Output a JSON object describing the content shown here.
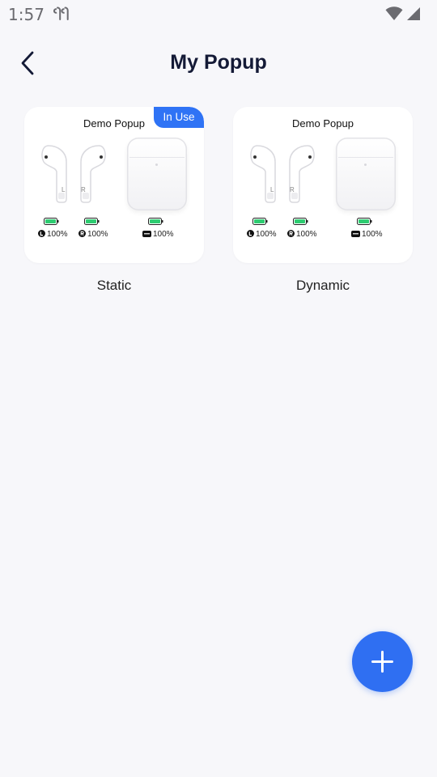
{
  "status_bar": {
    "time": "1:57"
  },
  "header": {
    "title": "My Popup"
  },
  "popups": [
    {
      "card_title": "Demo Popup",
      "badge": "In Use",
      "left_label": "L",
      "right_label": "R",
      "left_battery": "100%",
      "right_battery": "100%",
      "case_battery": "100%",
      "caption": "Static"
    },
    {
      "card_title": "Demo Popup",
      "left_label": "L",
      "right_label": "R",
      "left_battery": "100%",
      "right_battery": "100%",
      "case_battery": "100%",
      "caption": "Dynamic"
    }
  ],
  "colors": {
    "accent": "#2f6ff2",
    "badge": "#2f73f5",
    "battery": "#2ecc71",
    "title": "#141a36",
    "background": "#f7f7fa"
  },
  "icons": {
    "back": "chevron-left-icon",
    "add": "plus-icon",
    "wifi": "wifi-icon",
    "cellular": "cellular-signal-icon",
    "earbuds": "earbuds-icon"
  }
}
